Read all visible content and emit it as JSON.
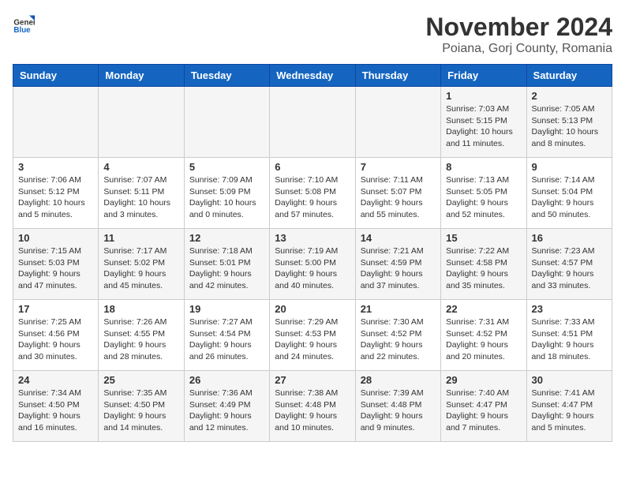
{
  "header": {
    "logo_general": "General",
    "logo_blue": "Blue",
    "month_title": "November 2024",
    "location": "Poiana, Gorj County, Romania"
  },
  "weekdays": [
    "Sunday",
    "Monday",
    "Tuesday",
    "Wednesday",
    "Thursday",
    "Friday",
    "Saturday"
  ],
  "weeks": [
    [
      {
        "day": "",
        "info": ""
      },
      {
        "day": "",
        "info": ""
      },
      {
        "day": "",
        "info": ""
      },
      {
        "day": "",
        "info": ""
      },
      {
        "day": "",
        "info": ""
      },
      {
        "day": "1",
        "info": "Sunrise: 7:03 AM\nSunset: 5:15 PM\nDaylight: 10 hours\nand 11 minutes."
      },
      {
        "day": "2",
        "info": "Sunrise: 7:05 AM\nSunset: 5:13 PM\nDaylight: 10 hours\nand 8 minutes."
      }
    ],
    [
      {
        "day": "3",
        "info": "Sunrise: 7:06 AM\nSunset: 5:12 PM\nDaylight: 10 hours\nand 5 minutes."
      },
      {
        "day": "4",
        "info": "Sunrise: 7:07 AM\nSunset: 5:11 PM\nDaylight: 10 hours\nand 3 minutes."
      },
      {
        "day": "5",
        "info": "Sunrise: 7:09 AM\nSunset: 5:09 PM\nDaylight: 10 hours\nand 0 minutes."
      },
      {
        "day": "6",
        "info": "Sunrise: 7:10 AM\nSunset: 5:08 PM\nDaylight: 9 hours\nand 57 minutes."
      },
      {
        "day": "7",
        "info": "Sunrise: 7:11 AM\nSunset: 5:07 PM\nDaylight: 9 hours\nand 55 minutes."
      },
      {
        "day": "8",
        "info": "Sunrise: 7:13 AM\nSunset: 5:05 PM\nDaylight: 9 hours\nand 52 minutes."
      },
      {
        "day": "9",
        "info": "Sunrise: 7:14 AM\nSunset: 5:04 PM\nDaylight: 9 hours\nand 50 minutes."
      }
    ],
    [
      {
        "day": "10",
        "info": "Sunrise: 7:15 AM\nSunset: 5:03 PM\nDaylight: 9 hours\nand 47 minutes."
      },
      {
        "day": "11",
        "info": "Sunrise: 7:17 AM\nSunset: 5:02 PM\nDaylight: 9 hours\nand 45 minutes."
      },
      {
        "day": "12",
        "info": "Sunrise: 7:18 AM\nSunset: 5:01 PM\nDaylight: 9 hours\nand 42 minutes."
      },
      {
        "day": "13",
        "info": "Sunrise: 7:19 AM\nSunset: 5:00 PM\nDaylight: 9 hours\nand 40 minutes."
      },
      {
        "day": "14",
        "info": "Sunrise: 7:21 AM\nSunset: 4:59 PM\nDaylight: 9 hours\nand 37 minutes."
      },
      {
        "day": "15",
        "info": "Sunrise: 7:22 AM\nSunset: 4:58 PM\nDaylight: 9 hours\nand 35 minutes."
      },
      {
        "day": "16",
        "info": "Sunrise: 7:23 AM\nSunset: 4:57 PM\nDaylight: 9 hours\nand 33 minutes."
      }
    ],
    [
      {
        "day": "17",
        "info": "Sunrise: 7:25 AM\nSunset: 4:56 PM\nDaylight: 9 hours\nand 30 minutes."
      },
      {
        "day": "18",
        "info": "Sunrise: 7:26 AM\nSunset: 4:55 PM\nDaylight: 9 hours\nand 28 minutes."
      },
      {
        "day": "19",
        "info": "Sunrise: 7:27 AM\nSunset: 4:54 PM\nDaylight: 9 hours\nand 26 minutes."
      },
      {
        "day": "20",
        "info": "Sunrise: 7:29 AM\nSunset: 4:53 PM\nDaylight: 9 hours\nand 24 minutes."
      },
      {
        "day": "21",
        "info": "Sunrise: 7:30 AM\nSunset: 4:52 PM\nDaylight: 9 hours\nand 22 minutes."
      },
      {
        "day": "22",
        "info": "Sunrise: 7:31 AM\nSunset: 4:52 PM\nDaylight: 9 hours\nand 20 minutes."
      },
      {
        "day": "23",
        "info": "Sunrise: 7:33 AM\nSunset: 4:51 PM\nDaylight: 9 hours\nand 18 minutes."
      }
    ],
    [
      {
        "day": "24",
        "info": "Sunrise: 7:34 AM\nSunset: 4:50 PM\nDaylight: 9 hours\nand 16 minutes."
      },
      {
        "day": "25",
        "info": "Sunrise: 7:35 AM\nSunset: 4:50 PM\nDaylight: 9 hours\nand 14 minutes."
      },
      {
        "day": "26",
        "info": "Sunrise: 7:36 AM\nSunset: 4:49 PM\nDaylight: 9 hours\nand 12 minutes."
      },
      {
        "day": "27",
        "info": "Sunrise: 7:38 AM\nSunset: 4:48 PM\nDaylight: 9 hours\nand 10 minutes."
      },
      {
        "day": "28",
        "info": "Sunrise: 7:39 AM\nSunset: 4:48 PM\nDaylight: 9 hours\nand 9 minutes."
      },
      {
        "day": "29",
        "info": "Sunrise: 7:40 AM\nSunset: 4:47 PM\nDaylight: 9 hours\nand 7 minutes."
      },
      {
        "day": "30",
        "info": "Sunrise: 7:41 AM\nSunset: 4:47 PM\nDaylight: 9 hours\nand 5 minutes."
      }
    ]
  ]
}
